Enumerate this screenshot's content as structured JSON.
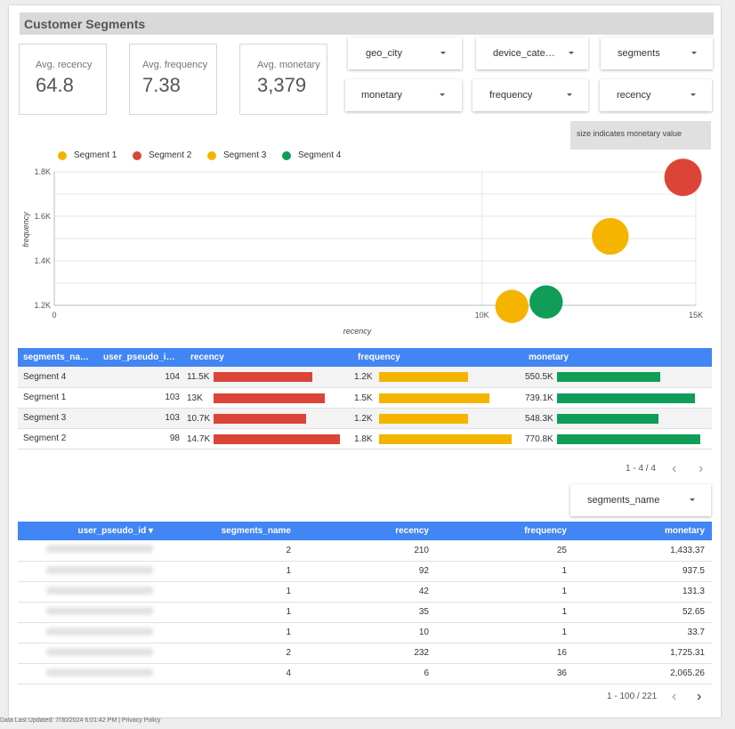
{
  "title": "Customer Segments",
  "kpis": [
    {
      "label": "Avg. recency",
      "value": "64.8"
    },
    {
      "label": "Avg. frequency",
      "value": "7.38"
    },
    {
      "label": "Avg. monetary",
      "value": "3,379"
    }
  ],
  "filters": [
    "geo_city",
    "device_cate…",
    "segments",
    "monetary",
    "frequency",
    "recency"
  ],
  "size_note": "size indicates monetary value",
  "legend": [
    {
      "label": "Segment 1",
      "color": "#f4b400"
    },
    {
      "label": "Segment 2",
      "color": "#db4437"
    },
    {
      "label": "Segment 3",
      "color": "#f4b400"
    },
    {
      "label": "Segment 4",
      "color": "#0f9d58"
    }
  ],
  "chart_data": {
    "type": "scatter",
    "xlabel": "recency",
    "ylabel": "frequency",
    "xlim": [
      0,
      15000
    ],
    "ylim": [
      1200,
      1800
    ],
    "x_ticks": [
      "0",
      "10K",
      "15K"
    ],
    "y_ticks": [
      "1.2K",
      "1.4K",
      "1.6K",
      "1.8K"
    ],
    "series": [
      {
        "name": "Segment 1",
        "color": "#f4b400",
        "x": 13000,
        "y": 1510,
        "monetary": 739100
      },
      {
        "name": "Segment 2",
        "color": "#db4437",
        "x": 14700,
        "y": 1775,
        "monetary": 770800
      },
      {
        "name": "Segment 3",
        "color": "#f4b400",
        "x": 10700,
        "y": 1195,
        "monetary": 548300
      },
      {
        "name": "Segment 4",
        "color": "#0f9d58",
        "x": 11500,
        "y": 1215,
        "monetary": 550500
      }
    ]
  },
  "segment_table": {
    "headers": [
      "segments_na…",
      "user_pseudo_i…",
      "recency",
      "frequency",
      "monetary"
    ],
    "rows": [
      {
        "name": "Segment 4",
        "users": "104",
        "recency": "11.5K",
        "recency_frac": 0.78,
        "frequency": "1.2K",
        "frequency_frac": 0.67,
        "monetary": "550.5K",
        "monetary_frac": 0.72
      },
      {
        "name": "Segment 1",
        "users": "103",
        "recency": "13K",
        "recency_frac": 0.88,
        "frequency": "1.5K",
        "frequency_frac": 0.83,
        "monetary": "739.1K",
        "monetary_frac": 0.96
      },
      {
        "name": "Segment 3",
        "users": "103",
        "recency": "10.7K",
        "recency_frac": 0.73,
        "frequency": "1.2K",
        "frequency_frac": 0.67,
        "monetary": "548.3K",
        "monetary_frac": 0.71
      },
      {
        "name": "Segment 2",
        "users": "98",
        "recency": "14.7K",
        "recency_frac": 1.0,
        "frequency": "1.8K",
        "frequency_frac": 1.0,
        "monetary": "770.8K",
        "monetary_frac": 1.0
      }
    ],
    "colors": {
      "recency": "#db4437",
      "frequency": "#f4b400",
      "monetary": "#0f9d58"
    },
    "pagination": "1 - 4 / 4"
  },
  "segments_name_filter": "segments_name",
  "user_table": {
    "headers": [
      "user_pseudo_id",
      "segments_name",
      "recency",
      "frequency",
      "monetary"
    ],
    "sort_indicator": "▾",
    "rows": [
      {
        "segments_name": "2",
        "recency": "210",
        "frequency": "25",
        "monetary": "1,433.37"
      },
      {
        "segments_name": "1",
        "recency": "92",
        "frequency": "1",
        "monetary": "937.5"
      },
      {
        "segments_name": "1",
        "recency": "42",
        "frequency": "1",
        "monetary": "131.3"
      },
      {
        "segments_name": "1",
        "recency": "35",
        "frequency": "1",
        "monetary": "52.65"
      },
      {
        "segments_name": "1",
        "recency": "10",
        "frequency": "1",
        "monetary": "33.7"
      },
      {
        "segments_name": "2",
        "recency": "232",
        "frequency": "16",
        "monetary": "1,725.31"
      },
      {
        "segments_name": "4",
        "recency": "6",
        "frequency": "36",
        "monetary": "2,065.26"
      }
    ],
    "pagination": "1 - 100 / 221"
  },
  "footer": "Data Last Updated: 7/30/2024 6:01:42 PM | Privacy Policy"
}
